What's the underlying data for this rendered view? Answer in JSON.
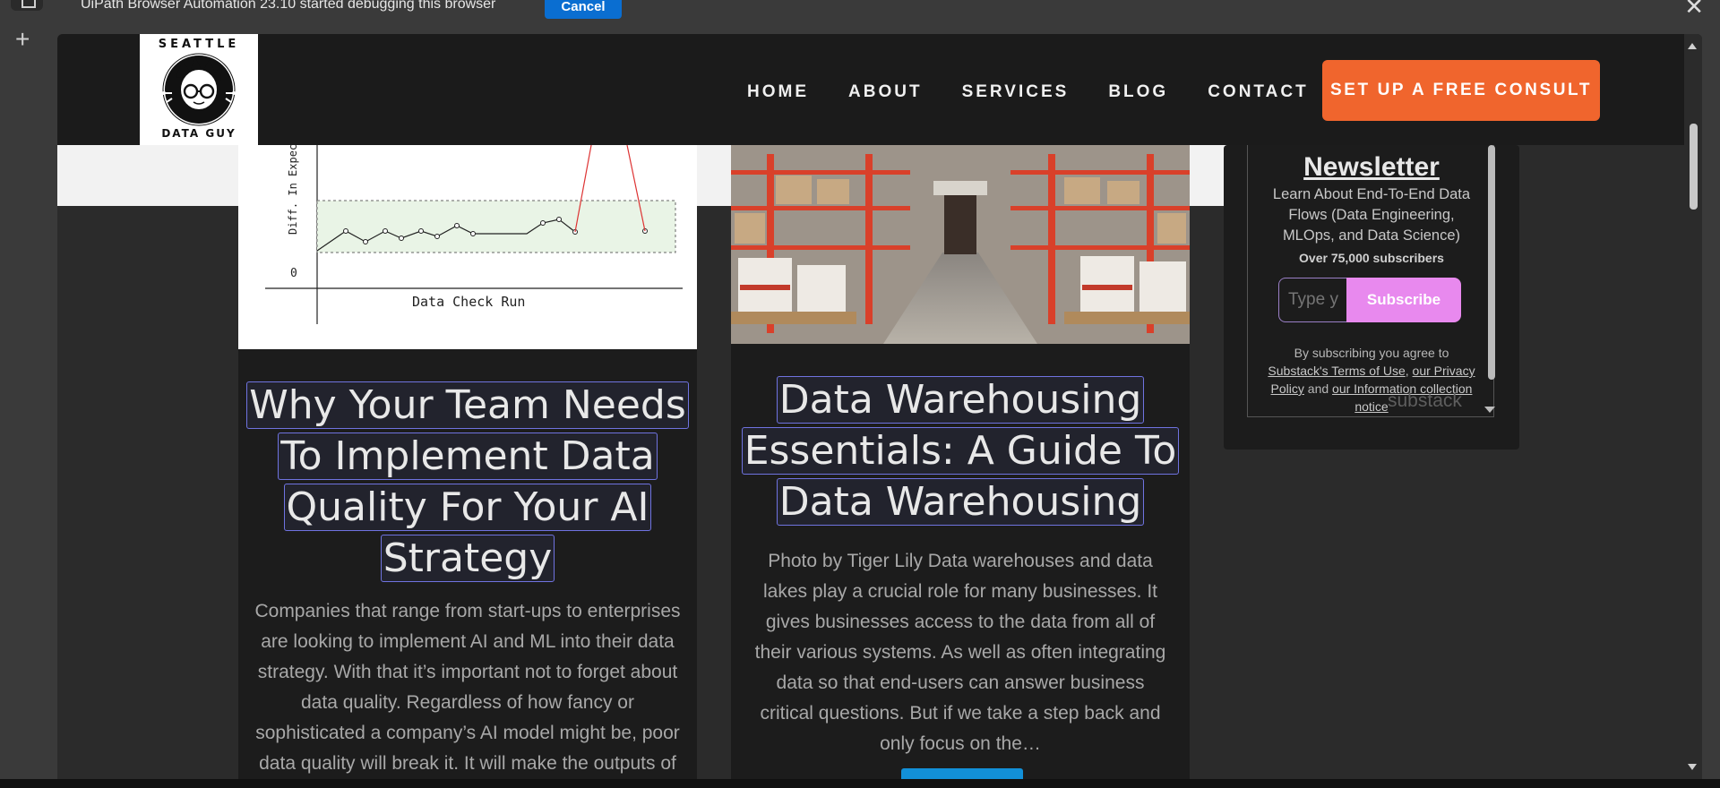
{
  "browser": {
    "infobar_text": "UiPath Browser Automation 23.10  started debugging this browser",
    "cancel_label": "Cancel",
    "new_tab_symbol": "+",
    "close_symbol": "✕"
  },
  "site": {
    "logo": {
      "top_text": "SEATTLE",
      "bottom_text": "DATA GUY"
    },
    "nav": [
      {
        "label": "HOME"
      },
      {
        "label": "ABOUT"
      },
      {
        "label": "SERVICES"
      },
      {
        "label": "BLOG"
      },
      {
        "label": "CONTACT"
      }
    ],
    "cta_label": "SET UP A FREE CONSULT"
  },
  "posts": [
    {
      "title_lines": [
        "Why Your Team Needs",
        "To Implement Data",
        "Quality For Your AI",
        "Strategy"
      ],
      "excerpt": "Companies that range from start-ups to enterprises are looking to implement AI and ML into their data strategy. With that it’s important not to forget about data quality. Regardless of how fancy or sophisticated a company’s AI model might be, poor data quality will break it. It will make the outputs of",
      "image": {
        "ylabel": "Diff. In Expected",
        "xlabel": "Data Check Run",
        "zero_label": "0"
      }
    },
    {
      "title_lines": [
        "Data Warehousing",
        "Essentials: A Guide To",
        "Data Warehousing"
      ],
      "excerpt": "Photo by Tiger Lily Data warehouses and data lakes play a crucial role for many businesses. It gives businesses access to the data from all of their various systems. As well as often integrating data so that end-users can answer business critical questions. But if we take a step back and only focus on the…"
    }
  ],
  "newsletter": {
    "title": "Newsletter",
    "description": "Learn About End-To-End Data Flows (Data Engineering, MLOps, and Data Science)",
    "subscribers": "Over 75,000 subscribers",
    "input_placeholder": "Type y",
    "subscribe_label": "Subscribe",
    "legal_prefix": "By subscribing you agree to",
    "legal_terms": "Substack's Terms of Use",
    "legal_comma": ", ",
    "legal_privacy": "our Privacy Policy",
    "legal_and": " and ",
    "legal_info": "our Information collection notice",
    "brand": "substack"
  },
  "colors": {
    "accent_cta": "#f0652d",
    "subscribe": "#e889ee",
    "cancel_button": "#0a6ed1",
    "highlight_border": "#6f73e0"
  }
}
